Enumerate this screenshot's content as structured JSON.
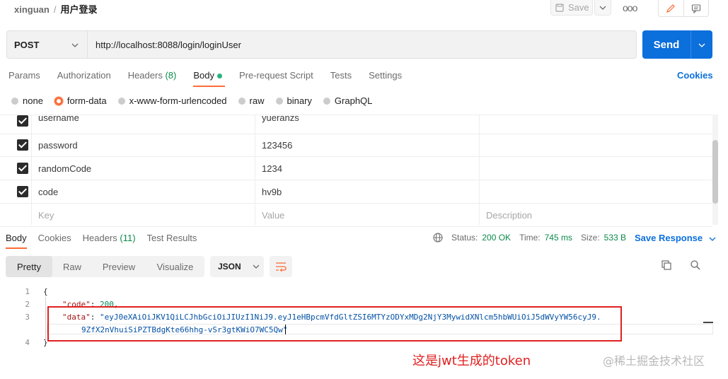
{
  "header": {
    "workspace": "xinguan",
    "separator": "/",
    "request_name": "用户登录",
    "save_label": "Save",
    "more_label": "ooo"
  },
  "request": {
    "method": "POST",
    "url": "http://localhost:8088/login/loginUser",
    "send_label": "Send"
  },
  "request_tabs": [
    {
      "label": "Params"
    },
    {
      "label": "Authorization"
    },
    {
      "label": "Headers",
      "count": "(8)"
    },
    {
      "label": "Body"
    },
    {
      "label": "Pre-request Script"
    },
    {
      "label": "Tests"
    },
    {
      "label": "Settings"
    }
  ],
  "cookies_label": "Cookies",
  "body_types": [
    "none",
    "form-data",
    "x-www-form-urlencoded",
    "raw",
    "binary",
    "GraphQL"
  ],
  "params": [
    {
      "key": "username",
      "value": "yueranzs"
    },
    {
      "key": "password",
      "value": "123456"
    },
    {
      "key": "randomCode",
      "value": "1234"
    },
    {
      "key": "code",
      "value": "hv9b"
    }
  ],
  "params_placeholder": {
    "key": "Key",
    "value": "Value",
    "description": "Description"
  },
  "response": {
    "tabs": [
      {
        "label": "Body"
      },
      {
        "label": "Cookies"
      },
      {
        "label": "Headers",
        "count": "(11)"
      },
      {
        "label": "Test Results"
      }
    ],
    "status_label": "Status:",
    "status_value": "200 OK",
    "time_label": "Time:",
    "time_value": "745 ms",
    "size_label": "Size:",
    "size_value": "533 B",
    "save_response_label": "Save Response",
    "views": [
      "Pretty",
      "Raw",
      "Preview",
      "Visualize"
    ],
    "format": "JSON"
  },
  "code": {
    "line_numbers": [
      "1",
      "2",
      "3",
      "4"
    ],
    "open_brace": "{",
    "code_key": "\"code\"",
    "code_value": "200",
    "data_key": "\"data\"",
    "data_value_1": "\"eyJ0eXAiOiJKV1QiLCJhbGciOiJIUzI1NiJ9.eyJ1eHBpcmVfdGltZSI6MTYzODYxMDg2NjY3MywidXNlcm5hbWUiOiJ5dWVyYW56cyJ9.",
    "data_value_2": "9ZfX2nVhuiSiPZTBdgKte66hhg-vSr3gtKWiO7WC5Qw\"",
    "close_brace": "}"
  },
  "annotation": "这是jwt生成的token",
  "watermark": "@稀土掘金技术社区",
  "colors": {
    "accent": "#ff6c37",
    "send": "#0b6fdc",
    "success": "#0b8a4a",
    "annotation": "#e02020"
  }
}
